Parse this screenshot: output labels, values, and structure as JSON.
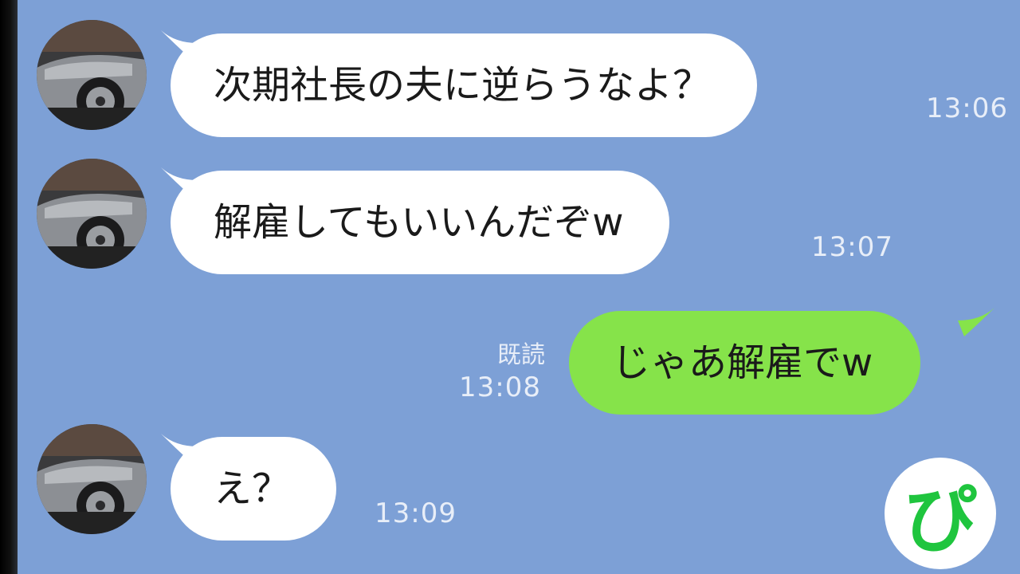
{
  "chat": {
    "messages": [
      {
        "side": "in",
        "text": "次期社長の夫に逆らうなよ？",
        "time": "13:06"
      },
      {
        "side": "in",
        "text": "解雇してもいいんだぞw",
        "time": "13:07"
      },
      {
        "side": "out",
        "text": "じゃあ解雇でw",
        "time": "13:08",
        "read": "既読"
      },
      {
        "side": "in",
        "text": "え？",
        "time": "13:09"
      }
    ]
  },
  "logo": {
    "text": "ぴ"
  },
  "icons": {
    "avatar": "car-photo",
    "logo": "pi-logo"
  },
  "colors": {
    "background": "#7da0d6",
    "incoming_bubble": "#ffffff",
    "outgoing_bubble": "#86e34a",
    "logo_accent": "#1fc53e"
  }
}
